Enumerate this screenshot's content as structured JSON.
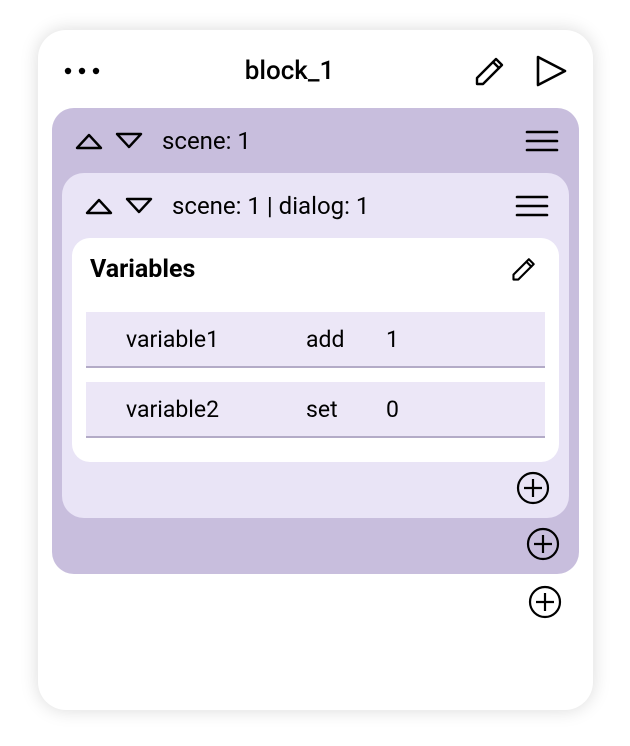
{
  "header": {
    "title": "block_1"
  },
  "scene": {
    "label": "scene: 1"
  },
  "dialog": {
    "label": "scene: 1 | dialog: 1"
  },
  "variables": {
    "title": "Variables",
    "rows": [
      {
        "name": "variable1",
        "op": "add",
        "value": "1"
      },
      {
        "name": "variable2",
        "op": "set",
        "value": "0"
      }
    ]
  }
}
